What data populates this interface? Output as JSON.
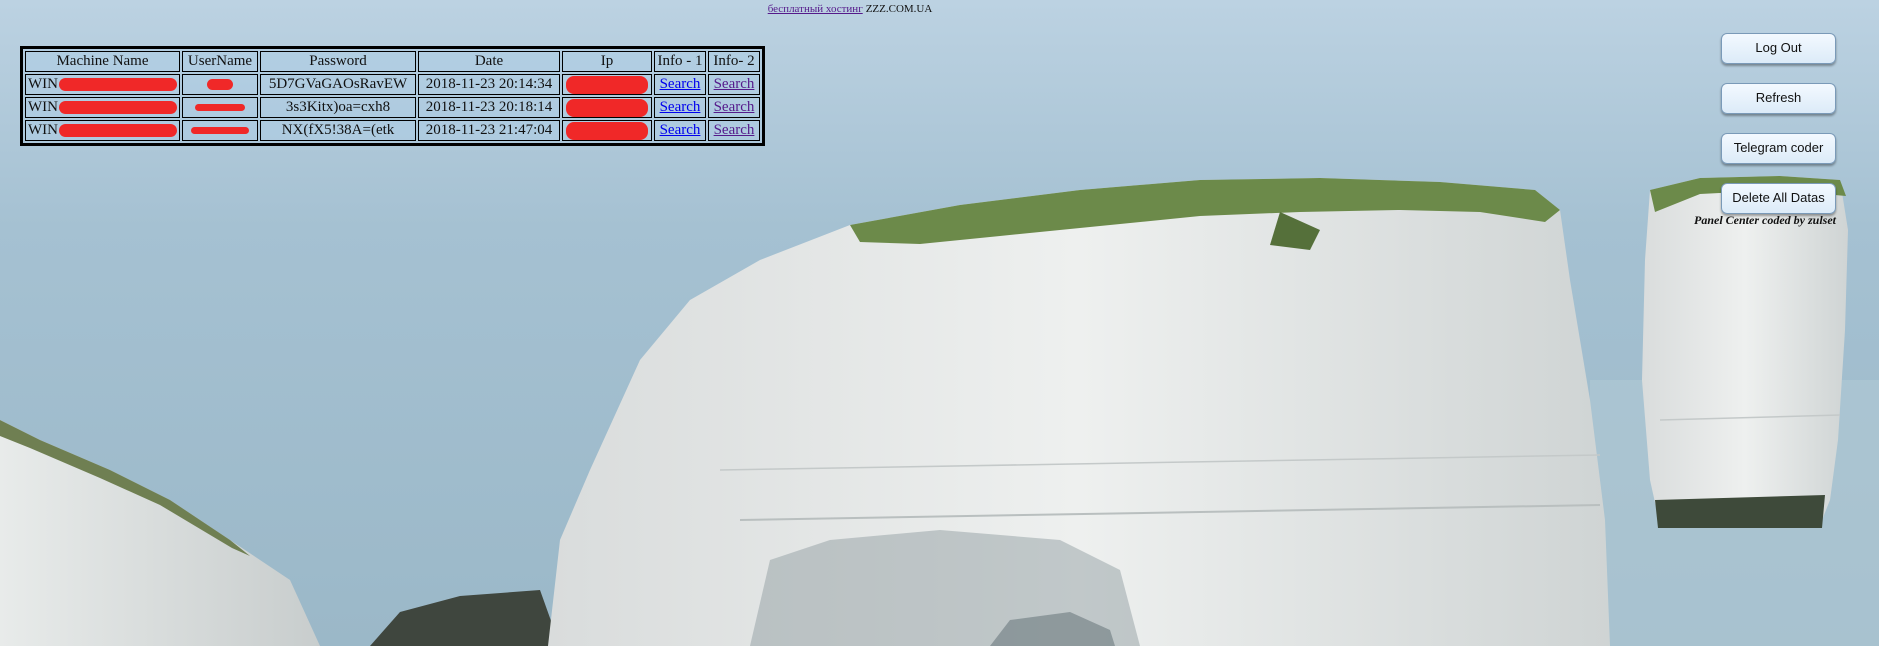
{
  "banner": {
    "link_text": "бесплатный хостинг",
    "domain_text": "ZZZ.COM.UA"
  },
  "table": {
    "headers": [
      "Machine Name",
      "UserName",
      "Password",
      "Date",
      "Ip",
      "Info - 1",
      "Info- 2"
    ],
    "rows": [
      {
        "machine_prefix": "WIN",
        "password": "5D7GVaGAOsRavEW",
        "date": "2018-11-23 20:14:34",
        "info1": "Search",
        "info2": "Search"
      },
      {
        "machine_prefix": "WIN",
        "password": "3s3Kitx)oa=cxh8",
        "date": "2018-11-23 20:18:14",
        "info1": "Search",
        "info2": "Search"
      },
      {
        "machine_prefix": "WIN",
        "password": "NX(fX5!38A=(etk",
        "date": "2018-11-23 21:47:04",
        "info1": "Search",
        "info2": "Search"
      }
    ]
  },
  "controls": {
    "logout": "Log Out",
    "refresh": "Refresh",
    "telegram": "Telegram coder",
    "delete_all": "Delete All Datas"
  },
  "credit": "Panel Center coded by zulset",
  "colors": {
    "redaction": "#f02828",
    "sky": "#b9d0e0",
    "sea": "#9dbccd"
  }
}
